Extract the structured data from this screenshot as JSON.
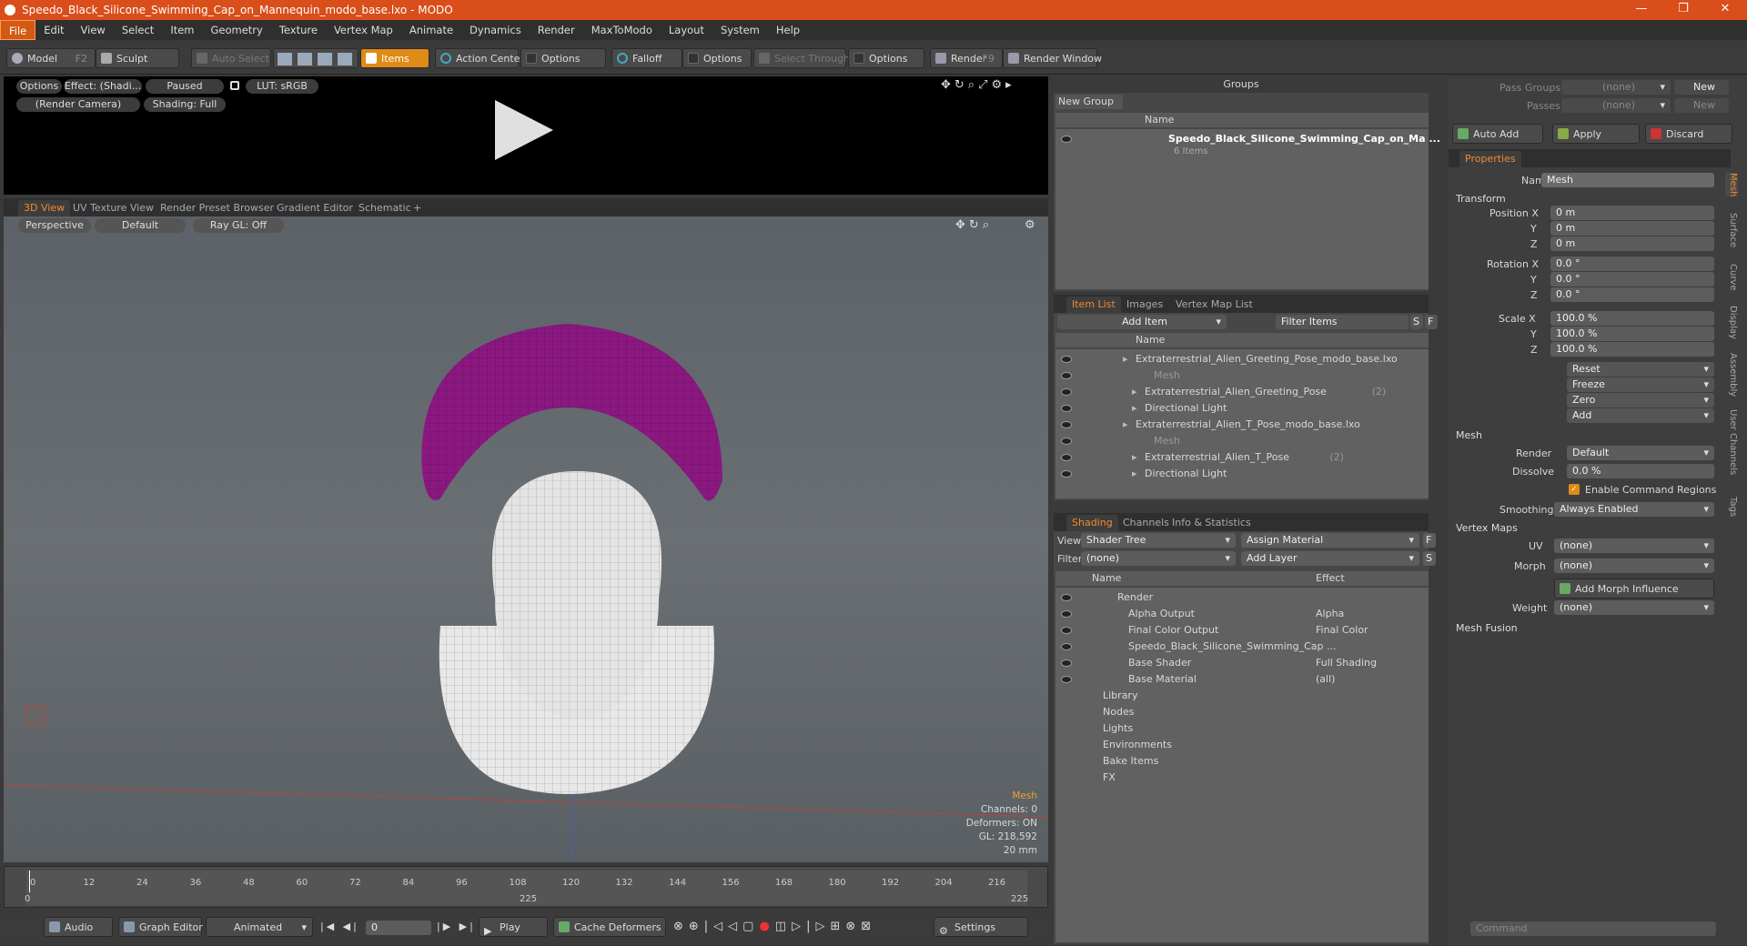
{
  "window": {
    "title": "Speedo_Black_Silicone_Swimming_Cap_on_Mannequin_modo_base.lxo - MODO"
  },
  "menu": [
    "File",
    "Edit",
    "View",
    "Select",
    "Item",
    "Geometry",
    "Texture",
    "Vertex Map",
    "Animate",
    "Dynamics",
    "Render",
    "MaxToModo",
    "Layout",
    "System",
    "Help"
  ],
  "toolbar": {
    "model": "Model",
    "model_key": "F2",
    "sculpt": "Sculpt",
    "auto_select": "Auto Select",
    "items": "Items",
    "action_center": "Action Center",
    "options1": "Options",
    "falloff": "Falloff",
    "options2": "Options",
    "select_through": "Select Through",
    "options3": "Options",
    "render": "Render",
    "render_key": "F9",
    "render_window": "Render Window"
  },
  "preview": {
    "options": "Options",
    "effect": "Effect: (Shadi...",
    "paused": "Paused",
    "lut": "LUT: sRGB",
    "camera": "(Render Camera)",
    "shading": "Shading: Full"
  },
  "viewport_tabs": [
    "3D View",
    "UV Texture View",
    "Render Preset Browser",
    "Gradient Editor",
    "Schematic"
  ],
  "viewport": {
    "perspective": "Perspective",
    "default": "Default",
    "raygl": "Ray GL: Off",
    "info": [
      "Mesh",
      "Channels: 0",
      "Deformers: ON",
      "GL: 218,592",
      "20 mm"
    ]
  },
  "timeline": {
    "ticks": [
      "0",
      "12",
      "24",
      "36",
      "48",
      "60",
      "72",
      "84",
      "96",
      "108",
      "120",
      "132",
      "144",
      "156",
      "168",
      "180",
      "192",
      "204",
      "216"
    ],
    "sub_start": "0",
    "sub_mid": "225",
    "sub_end": "225"
  },
  "bottombar": {
    "audio": "Audio",
    "graph_editor": "Graph Editor",
    "animated": "Animated",
    "frame": "0",
    "play": "Play",
    "cache": "Cache Deformers",
    "settings": "Settings"
  },
  "groups": {
    "title": "Groups",
    "new_group": "New Group",
    "col_name": "Name",
    "item": "Speedo_Black_Silicone_Swimming_Cap_on_Ma ...",
    "item_sub": "6 Items"
  },
  "itemlist": {
    "tabs": [
      "Item List",
      "Images",
      "Vertex Map List"
    ],
    "add_item": "Add Item",
    "filter": "Filter Items",
    "s": "S",
    "f": "F",
    "col_name": "Name",
    "rows": [
      {
        "t": "Extraterrestrial_Alien_Greeting_Pose_modo_base.lxo",
        "ind": 0
      },
      {
        "t": "Mesh",
        "ind": 2,
        "dim": true
      },
      {
        "t": "Extraterrestrial_Alien_Greeting_Pose",
        "cnt": "(2)",
        "ind": 1
      },
      {
        "t": "Directional Light",
        "ind": 1
      },
      {
        "t": "Extraterrestrial_Alien_T_Pose_modo_base.lxo",
        "ind": 0
      },
      {
        "t": "Mesh",
        "ind": 2,
        "dim": true
      },
      {
        "t": "Extraterrestrial_Alien_T_Pose",
        "cnt": "(2)",
        "ind": 1
      },
      {
        "t": "Directional Light",
        "ind": 1
      }
    ]
  },
  "shading": {
    "tabs": [
      "Shading",
      "Channels",
      "Info & Statistics"
    ],
    "view_label": "View",
    "view": "Shader Tree",
    "assign": "Assign Material",
    "filter_label": "Filter",
    "filter": "(none)",
    "add_layer": "Add Layer",
    "f": "F",
    "s": "S",
    "col_name": "Name",
    "col_effect": "Effect",
    "rows": [
      {
        "n": "Render",
        "e": ""
      },
      {
        "n": "Alpha Output",
        "e": "Alpha"
      },
      {
        "n": "Final Color Output",
        "e": "Final Color"
      },
      {
        "n": "Speedo_Black_Silicone_Swimming_Cap ...",
        "e": ""
      },
      {
        "n": "Base Shader",
        "e": "Full Shading"
      },
      {
        "n": "Base Material",
        "e": "(all)"
      },
      {
        "n": "Library",
        "e": ""
      },
      {
        "n": "Nodes",
        "e": ""
      },
      {
        "n": "Lights",
        "e": ""
      },
      {
        "n": "Environments",
        "e": ""
      },
      {
        "n": "Bake Items",
        "e": ""
      },
      {
        "n": "FX",
        "e": ""
      }
    ]
  },
  "right": {
    "pass_groups": "Pass Groups",
    "passes": "Passes",
    "none": "(none)",
    "new": "New",
    "auto_add": "Auto Add",
    "apply": "Apply",
    "discard": "Discard",
    "properties": "Properties",
    "name_label": "Name",
    "name": "Mesh",
    "transform": "Transform",
    "pos_x": "Position X",
    "y": "Y",
    "z": "Z",
    "rot_x": "Rotation X",
    "scale_x": "Scale X",
    "pos": [
      "0 m",
      "0 m",
      "0 m"
    ],
    "rot": [
      "0.0 °",
      "0.0 °",
      "0.0 °"
    ],
    "scale": [
      "100.0 %",
      "100.0 %",
      "100.0 %"
    ],
    "reset": "Reset",
    "freeze": "Freeze",
    "zero": "Zero",
    "add": "Add",
    "mesh": "Mesh",
    "render_label": "Render",
    "render": "Default",
    "dissolve_label": "Dissolve",
    "dissolve": "0.0 %",
    "enable_cmd": "Enable Command Regions",
    "smoothing_label": "Smoothing",
    "smoothing": "Always Enabled",
    "vertex_maps": "Vertex Maps",
    "uv_label": "UV",
    "uv": "(none)",
    "morph_label": "Morph",
    "morph": "(none)",
    "add_morph": "Add Morph Influence",
    "weight_label": "Weight",
    "weight": "(none)",
    "mesh_fusion": "Mesh Fusion",
    "command": "Command",
    "vtabs": [
      "Mesh",
      "Surface",
      "Curve",
      "Display",
      "Assembly",
      "User Channels",
      "Tags"
    ]
  }
}
